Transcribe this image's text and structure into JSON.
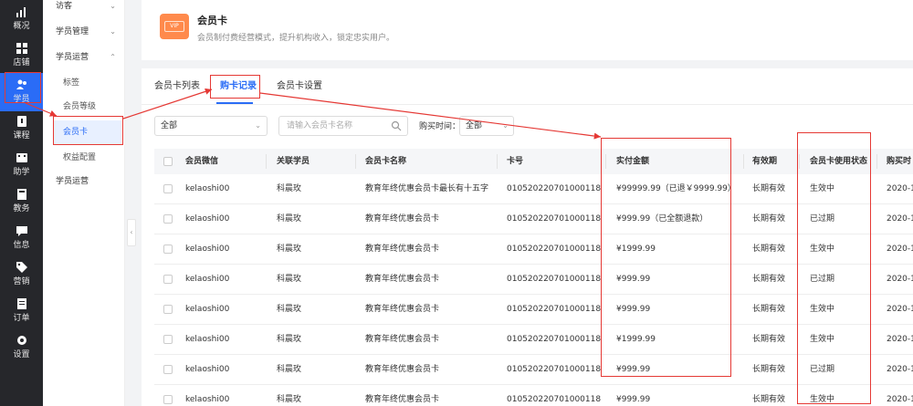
{
  "rail": [
    {
      "label": "概况",
      "icon": "chart-icon"
    },
    {
      "label": "店铺",
      "icon": "store-icon"
    },
    {
      "label": "学员",
      "icon": "users-icon"
    },
    {
      "label": "课程",
      "icon": "course-icon"
    },
    {
      "label": "助学",
      "icon": "film-icon"
    },
    {
      "label": "教务",
      "icon": "book-icon"
    },
    {
      "label": "信息",
      "icon": "message-icon"
    },
    {
      "label": "营销",
      "icon": "tag-icon"
    },
    {
      "label": "订单",
      "icon": "order-icon"
    },
    {
      "label": "设置",
      "icon": "gear-icon"
    }
  ],
  "submenu": {
    "visitor": "访客",
    "student_manage": "学员管理",
    "student_ops": "学员运营",
    "tags": "标签",
    "member_level": "会员等级",
    "member_card": "会员卡",
    "rights_config": "权益配置",
    "student_ops2": "学员运营"
  },
  "header": {
    "icon_text": "VIP",
    "title": "会员卡",
    "desc": "会员制付费经营模式，提升机构收入，锁定忠实用户。"
  },
  "tabs": [
    "会员卡列表",
    "购卡记录",
    "会员卡设置"
  ],
  "filters": {
    "select_value": "全部",
    "search_placeholder": "请输入会员卡名称",
    "time_label": "购买时间：",
    "time_value": "全部"
  },
  "table": {
    "headers": [
      "会员微信",
      "关联学员",
      "会员卡名称",
      "卡号",
      "实付金额",
      "有效期",
      "会员卡使用状态",
      "购买时"
    ],
    "rows": [
      [
        "kelaoshi00",
        "科晨玫",
        "教育年终优惠会员卡最长有十五字",
        "010520220701000118",
        "¥99999.99（已退￥9999.99）",
        "长期有效",
        "生效中",
        "2020-1"
      ],
      [
        "kelaoshi00",
        "科晨玫",
        "教育年终优惠会员卡",
        "010520220701000118",
        "¥999.99（已全额退款）",
        "长期有效",
        "已过期",
        "2020-1"
      ],
      [
        "kelaoshi00",
        "科晨玫",
        "教育年终优惠会员卡",
        "010520220701000118",
        "¥1999.99",
        "长期有效",
        "生效中",
        "2020-1"
      ],
      [
        "kelaoshi00",
        "科晨玫",
        "教育年终优惠会员卡",
        "010520220701000118",
        "¥999.99",
        "长期有效",
        "已过期",
        "2020-1"
      ],
      [
        "kelaoshi00",
        "科晨玫",
        "教育年终优惠会员卡",
        "010520220701000118",
        "¥999.99",
        "长期有效",
        "生效中",
        "2020-1"
      ],
      [
        "kelaoshi00",
        "科晨玫",
        "教育年终优惠会员卡",
        "010520220701000118",
        "¥1999.99",
        "长期有效",
        "生效中",
        "2020-1"
      ],
      [
        "kelaoshi00",
        "科晨玫",
        "教育年终优惠会员卡",
        "010520220701000118",
        "¥999.99",
        "长期有效",
        "已过期",
        "2020-1"
      ],
      [
        "kelaoshi00",
        "科晨玫",
        "教育年终优惠会员卡",
        "010520220701000118",
        "¥999.99",
        "长期有效",
        "生效中",
        "2020-1"
      ]
    ]
  },
  "colors": {
    "accent": "#2a6cf6",
    "annotation": "#e53935",
    "rail_bg": "#26272b"
  }
}
